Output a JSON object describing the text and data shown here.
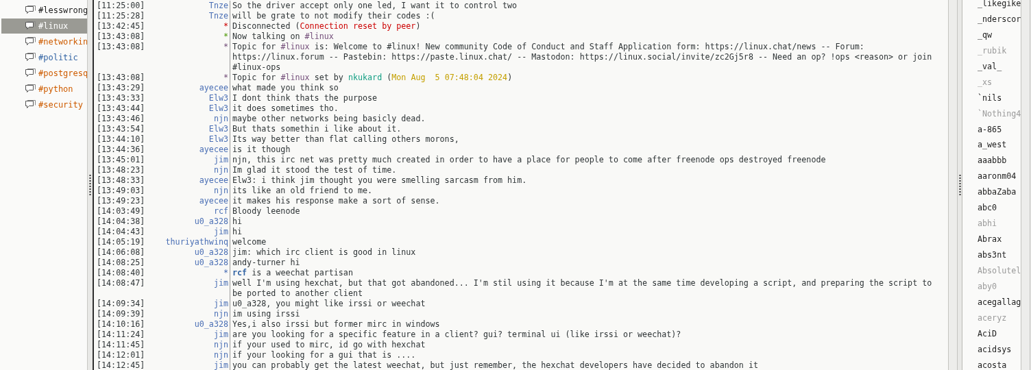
{
  "channels": [
    {
      "name": "#lesswrong",
      "selected": false,
      "color": "#1c1c1c"
    },
    {
      "name": "#linux",
      "selected": true
    },
    {
      "name": "#networkin",
      "selected": false,
      "color": "#ce5c00"
    },
    {
      "name": "#politic",
      "selected": false,
      "color": "#3465a4"
    },
    {
      "name": "#postgresq",
      "selected": false,
      "color": "#ce5c00"
    },
    {
      "name": "#python",
      "selected": false,
      "color": "#ce5c00"
    },
    {
      "name": "#security",
      "selected": false,
      "color": "#ce5c00"
    }
  ],
  "messages": [
    {
      "time": "[11:25:00]",
      "kind": "say",
      "nick": "Tnze",
      "segments": [
        {
          "text": "So the driver accept only one led, I want it to control two",
          "kind": "plain"
        }
      ]
    },
    {
      "time": "[11:25:28]",
      "kind": "say",
      "nick": "Tnze",
      "segments": [
        {
          "text": "will be grate to not modify their codes :(",
          "kind": "plain"
        }
      ]
    },
    {
      "time": "[13:42:45]",
      "kind": "error",
      "nick": "*",
      "segments": [
        {
          "text": "Disconnected (",
          "kind": "plain"
        },
        {
          "text": "Connection reset by peer",
          "kind": "error"
        },
        {
          "text": ")",
          "kind": "plain"
        }
      ]
    },
    {
      "time": "[13:43:08]",
      "kind": "join",
      "nick": "*",
      "segments": [
        {
          "text": "Now talking on ",
          "kind": "plain"
        },
        {
          "text": "#linux",
          "kind": "channel"
        }
      ]
    },
    {
      "time": "[13:43:08]",
      "kind": "topic",
      "nick": "*",
      "segments": [
        {
          "text": "Topic for ",
          "kind": "plain"
        },
        {
          "text": "#linux",
          "kind": "channel"
        },
        {
          "text": " is: Welcome to #linux! New community Code of Conduct and Staff Application form: https://linux.chat/news -- Forum: https://linux.forum -- Pastebin: https://paste.linux.chat/ -- Mastodon: https://linux.social/invite/zc2Gj5r8 -- Need an op? !ops <reason> or join #linux-ops",
          "kind": "plain"
        }
      ]
    },
    {
      "time": "[13:43:08]",
      "kind": "topic",
      "nick": "*",
      "segments": [
        {
          "text": "Topic for ",
          "kind": "plain"
        },
        {
          "text": "#linux",
          "kind": "channel"
        },
        {
          "text": " set by ",
          "kind": "plain"
        },
        {
          "text": "nkukard",
          "kind": "nick"
        },
        {
          "text": " (",
          "kind": "plain"
        },
        {
          "text": "Mon Aug  5 07:48:04 2024",
          "kind": "date"
        },
        {
          "text": ")",
          "kind": "plain"
        }
      ]
    },
    {
      "time": "[13:43:29]",
      "kind": "say",
      "nick": "ayecee",
      "segments": [
        {
          "text": "what made you think so",
          "kind": "plain"
        }
      ]
    },
    {
      "time": "[13:43:33]",
      "kind": "say",
      "nick": "Elw3",
      "segments": [
        {
          "text": "I dont think thats the purpose",
          "kind": "plain"
        }
      ]
    },
    {
      "time": "[13:43:44]",
      "kind": "say",
      "nick": "Elw3",
      "segments": [
        {
          "text": "it does sometimes tho.",
          "kind": "plain"
        }
      ]
    },
    {
      "time": "[13:43:46]",
      "kind": "say",
      "nick": "njn",
      "segments": [
        {
          "text": "maybe other networks being basicly dead.",
          "kind": "plain"
        }
      ]
    },
    {
      "time": "[13:43:54]",
      "kind": "say",
      "nick": "Elw3",
      "segments": [
        {
          "text": "But thats somethin i like about it.",
          "kind": "plain"
        }
      ]
    },
    {
      "time": "[13:44:10]",
      "kind": "say",
      "nick": "Elw3",
      "segments": [
        {
          "text": "Its way better than flat calling others morons,",
          "kind": "plain"
        }
      ]
    },
    {
      "time": "[13:44:36]",
      "kind": "say",
      "nick": "ayecee",
      "segments": [
        {
          "text": "is it though",
          "kind": "plain"
        }
      ]
    },
    {
      "time": "[13:45:01]",
      "kind": "say",
      "nick": "jim",
      "segments": [
        {
          "text": "njn, this irc net was pretty much created in order to have a place for people to come after freenode ops destroyed freenode",
          "kind": "plain"
        }
      ]
    },
    {
      "time": "[13:48:23]",
      "kind": "say",
      "nick": "njn",
      "segments": [
        {
          "text": "Im glad it stood the test of time.",
          "kind": "plain"
        }
      ]
    },
    {
      "time": "[13:48:33]",
      "kind": "say",
      "nick": "ayecee",
      "segments": [
        {
          "text": "Elw3: i think jim thought you were smelling sarcasm from him.",
          "kind": "plain"
        }
      ]
    },
    {
      "time": "[13:49:03]",
      "kind": "say",
      "nick": "njn",
      "segments": [
        {
          "text": "its like an old friend to me.",
          "kind": "plain"
        }
      ]
    },
    {
      "time": "[13:49:23]",
      "kind": "say",
      "nick": "ayecee",
      "segments": [
        {
          "text": "it makes his response make a sort of sense.",
          "kind": "plain"
        }
      ]
    },
    {
      "time": "[14:03:49]",
      "kind": "say",
      "nick": "rcf",
      "segments": [
        {
          "text": "Bloody leenode",
          "kind": "plain"
        }
      ]
    },
    {
      "time": "[14:04:38]",
      "kind": "say",
      "nick": "u0_a328",
      "segments": [
        {
          "text": "hi",
          "kind": "plain"
        }
      ]
    },
    {
      "time": "[14:04:43]",
      "kind": "say",
      "nick": "jim",
      "segments": [
        {
          "text": "hi",
          "kind": "plain"
        }
      ]
    },
    {
      "time": "[14:05:19]",
      "kind": "say",
      "nick": "thuriyathwinq",
      "segments": [
        {
          "text": "welcome",
          "kind": "plain"
        }
      ]
    },
    {
      "time": "[14:06:08]",
      "kind": "say",
      "nick": "u0_a328",
      "segments": [
        {
          "text": "jim: which irc client is good in linux",
          "kind": "plain"
        }
      ]
    },
    {
      "time": "[14:08:25]",
      "kind": "say",
      "nick": "u0_a328",
      "segments": [
        {
          "text": "andy-turner hi",
          "kind": "plain"
        }
      ]
    },
    {
      "time": "[14:08:40]",
      "kind": "action",
      "nick": "*",
      "segments": [
        {
          "text": "rcf",
          "kind": "actor"
        },
        {
          "text": " is a weechat partisan",
          "kind": "plain"
        }
      ]
    },
    {
      "time": "[14:08:47]",
      "kind": "say",
      "nick": "jim",
      "segments": [
        {
          "text": "well I'm using hexchat, but that got abandoned... I'm stil using it because I'm at the same time developing a script, and preparing the script to be ported to another client",
          "kind": "plain"
        }
      ]
    },
    {
      "time": "[14:09:34]",
      "kind": "say",
      "nick": "jim",
      "segments": [
        {
          "text": "u0_a328, you might like irssi or weechat",
          "kind": "plain"
        }
      ]
    },
    {
      "time": "[14:09:39]",
      "kind": "say",
      "nick": "njn",
      "segments": [
        {
          "text": "im using irssi",
          "kind": "plain"
        }
      ]
    },
    {
      "time": "[14:10:16]",
      "kind": "say",
      "nick": "u0_a328",
      "segments": [
        {
          "text": "Yes,i also irssi but former mirc in windows",
          "kind": "plain"
        }
      ]
    },
    {
      "time": "[14:11:24]",
      "kind": "say",
      "nick": "jim",
      "segments": [
        {
          "text": "are you looking for a specific feature in a client? gui? terminal ui (like irssi or weechat)?",
          "kind": "plain"
        }
      ]
    },
    {
      "time": "[14:11:45]",
      "kind": "say",
      "nick": "njn",
      "segments": [
        {
          "text": "if your used to mirc, id go with hexchat",
          "kind": "plain"
        }
      ]
    },
    {
      "time": "[14:12:01]",
      "kind": "say",
      "nick": "njn",
      "segments": [
        {
          "text": "if your looking for a gui that is ....",
          "kind": "plain"
        }
      ]
    },
    {
      "time": "[14:12:45]",
      "kind": "say",
      "nick": "jim",
      "segments": [
        {
          "text": "you can probably get the latest weechat, but just remember, the hexchat developers have decided to abandon it",
          "kind": "plain"
        }
      ]
    }
  ],
  "users": [
    {
      "name": "_likegike",
      "away": false
    },
    {
      "name": "_nderscor",
      "away": false
    },
    {
      "name": "_qw",
      "away": false
    },
    {
      "name": "_rubik",
      "away": true
    },
    {
      "name": "_val_",
      "away": false
    },
    {
      "name": "_xs",
      "away": true
    },
    {
      "name": "`nils",
      "away": false
    },
    {
      "name": "`Nothing4",
      "away": true
    },
    {
      "name": "a-865",
      "away": false
    },
    {
      "name": "a_west",
      "away": false
    },
    {
      "name": "aaabbb",
      "away": false
    },
    {
      "name": "aaronm04",
      "away": false
    },
    {
      "name": "abbaZaba",
      "away": false
    },
    {
      "name": "abc0",
      "away": false
    },
    {
      "name": "abhi",
      "away": true
    },
    {
      "name": "Abrax",
      "away": false
    },
    {
      "name": "abs3nt",
      "away": false
    },
    {
      "name": "Absolutel",
      "away": true
    },
    {
      "name": "aby0",
      "away": true
    },
    {
      "name": "acegallag",
      "away": false
    },
    {
      "name": "aceryz",
      "away": true
    },
    {
      "name": "AciD",
      "away": false
    },
    {
      "name": "acidsys",
      "away": false
    },
    {
      "name": "acosta",
      "away": false
    }
  ]
}
